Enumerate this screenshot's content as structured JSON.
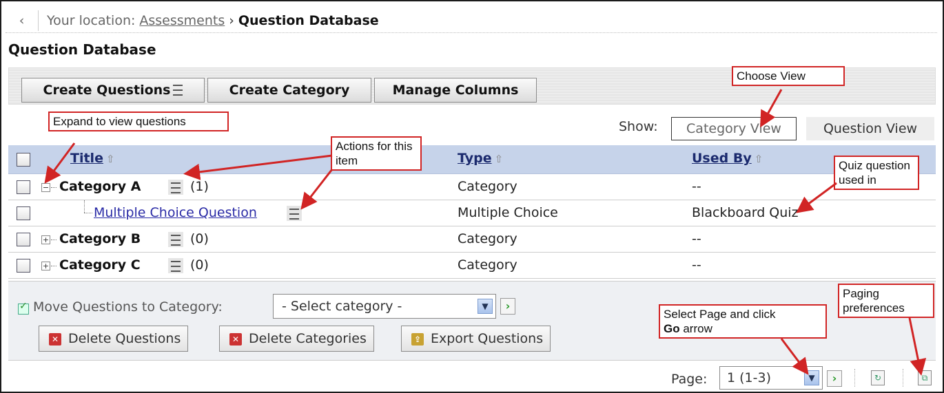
{
  "breadcrumb": {
    "back_glyph": "‹",
    "location_label": "Your location:",
    "parent_link": "Assessments",
    "separator": "›",
    "current": "Question Database"
  },
  "page_title": "Question Database",
  "toolbar": {
    "create_questions": "Create Questions",
    "create_category": "Create Category",
    "manage_columns": "Manage Columns"
  },
  "show": {
    "label": "Show:",
    "category_view": "Category View",
    "question_view": "Question View"
  },
  "table": {
    "headers": {
      "title": "Title",
      "type": "Type",
      "used_by": "Used By"
    },
    "sort_glyph": "⇧",
    "rows": [
      {
        "title": "Category A",
        "count": "(1)",
        "type": "Category",
        "used_by": "--",
        "expanded": true
      },
      {
        "title": "Multiple Choice Question",
        "type": "Multiple Choice",
        "used_by": "Blackboard Quiz"
      },
      {
        "title": "Category B",
        "count": "(0)",
        "type": "Category",
        "used_by": "--",
        "expanded": false
      },
      {
        "title": "Category C",
        "count": "(0)",
        "type": "Category",
        "used_by": "--",
        "expanded": false
      }
    ]
  },
  "footer": {
    "move_label": "Move Questions to Category:",
    "select_placeholder": "- Select category -",
    "delete_questions": "Delete Questions",
    "delete_categories": "Delete Categories",
    "export_questions": "Export Questions"
  },
  "pager": {
    "label": "Page:",
    "value": "1 (1-3)"
  },
  "callouts": {
    "expand": "Expand to view questions",
    "actions": "Actions for this item",
    "choose_view": "Choose View",
    "quiz_used": "Quiz question used in",
    "select_page_pre": "Select Page and click",
    "select_page_go": "Go",
    "select_page_post": " arrow",
    "paging": "Paging preferences"
  },
  "colors": {
    "header_bg": "#c6d3ea",
    "callout_border": "#d12424",
    "link": "#2a2ba6"
  }
}
